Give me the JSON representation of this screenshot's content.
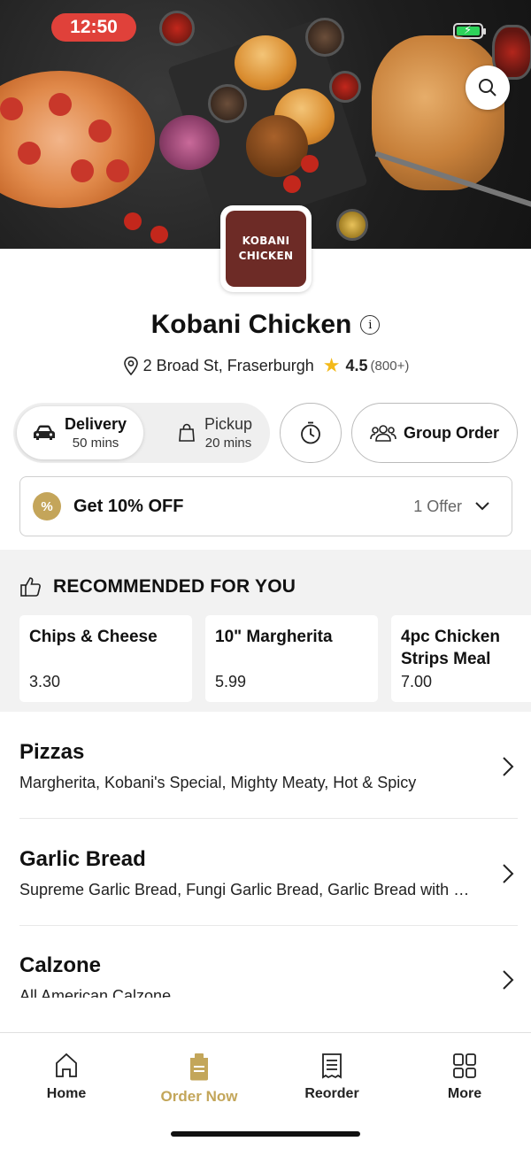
{
  "status_bar": {
    "time": "12:50"
  },
  "hero": {
    "logo_line1": "KOBANI",
    "logo_line2": "CHICKEN"
  },
  "restaurant": {
    "name": "Kobani Chicken",
    "address": "2 Broad St, Fraserburgh",
    "rating": "4.5",
    "rating_count": "(800+)"
  },
  "order_mode": {
    "delivery_label": "Delivery",
    "delivery_time": "50 mins",
    "pickup_label": "Pickup",
    "pickup_time": "20 mins",
    "group_order_label": "Group Order"
  },
  "offer": {
    "title": "Get 10% OFF",
    "count": "1 Offer",
    "badge": "%"
  },
  "recommended": {
    "heading": "RECOMMENDED FOR YOU",
    "items": [
      {
        "name": "Chips & Cheese",
        "price": "3.30"
      },
      {
        "name": "10\" Margherita",
        "price": "5.99"
      },
      {
        "name": "4pc Chicken Strips Meal",
        "price": "7.00"
      }
    ]
  },
  "categories": [
    {
      "name": "Pizzas",
      "desc": "Margherita, Kobani's Special, Mighty Meaty, Hot & Spicy"
    },
    {
      "name": "Garlic Bread",
      "desc": "Supreme Garlic Bread, Fungi Garlic Bread, Garlic Bread with Cheese"
    },
    {
      "name": "Calzone",
      "desc": "All American Calzone"
    }
  ],
  "tabbar": {
    "home": "Home",
    "order_now": "Order Now",
    "reorder": "Reorder",
    "more": "More"
  },
  "colors": {
    "accent": "#c3a65a",
    "logo_bg": "#6d2b26",
    "time_pill": "#e0413a",
    "star": "#f3b91a"
  },
  "icons": [
    "search-icon",
    "info-icon",
    "location-pin-icon",
    "star-icon",
    "car-icon",
    "bag-icon",
    "timer-icon",
    "group-icon",
    "discount-badge-icon",
    "chevron-down-icon",
    "thumbs-up-icon",
    "chevron-right-icon",
    "home-icon",
    "order-bag-icon",
    "receipt-icon",
    "grid-icon"
  ]
}
